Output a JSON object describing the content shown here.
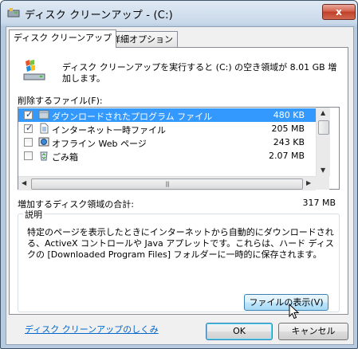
{
  "window": {
    "title": "ディスク クリーンアップ - (C:)",
    "close_glyph": "x"
  },
  "tabs": [
    {
      "label": "ディスク クリーンアップ"
    },
    {
      "label": "詳細オプション"
    }
  ],
  "header": {
    "text": "ディスク クリーンアップを実行すると (C:) の空き領域が 8.01 GB 増加します。"
  },
  "files": {
    "label": "削除するファイル(F):",
    "items": [
      {
        "name": "ダウンロードされたプログラム ファイル",
        "size": "480 KB",
        "checked": true,
        "selected": true
      },
      {
        "name": "インターネット一時ファイル",
        "size": "205 MB",
        "checked": true,
        "selected": false
      },
      {
        "name": "オフライン Web ページ",
        "size": "243 KB",
        "checked": false,
        "selected": false
      },
      {
        "name": "ごみ箱",
        "size": "2.07 MB",
        "checked": false,
        "selected": false
      }
    ]
  },
  "total": {
    "label": "増加するディスク領域の合計:",
    "value": "317 MB"
  },
  "description": {
    "title": "説明",
    "text": "特定のページを表示したときにインターネットから自動的にダウンロードされる、ActiveX コントロールや Java アプレットです。これらは、ハード ディスクの [Downloaded Program Files] フォルダーに一時的に保存されます。",
    "view_files_button": "ファイルの表示(V)"
  },
  "help_link": "ディスク クリーンアップのしくみ",
  "buttons": {
    "ok": "OK",
    "cancel": "キャンセル"
  }
}
